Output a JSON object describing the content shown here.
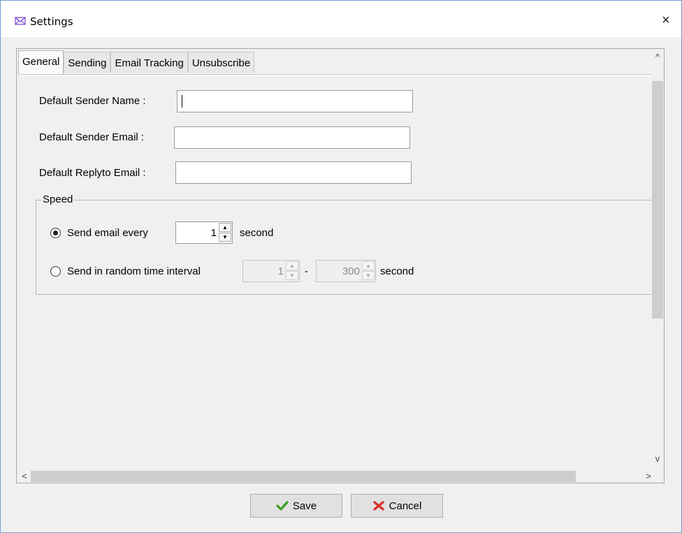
{
  "window": {
    "title": "Settings",
    "close_symbol": "×"
  },
  "tabs": [
    {
      "label": "General",
      "active": true
    },
    {
      "label": "Sending",
      "active": false
    },
    {
      "label": "Email Tracking",
      "active": false
    },
    {
      "label": "Unsubscribe",
      "active": false
    }
  ],
  "form": {
    "sender_name_label": "Default Sender Name :",
    "sender_name_value": "",
    "sender_email_label": "Default Sender Email :",
    "sender_email_value": "",
    "replyto_label": "Default Replyto Email :",
    "replyto_value": ""
  },
  "speed": {
    "group_label": "Speed",
    "option_every_label": "Send email every",
    "every_value": "1",
    "every_unit": "second",
    "option_random_label": "Send in random time interval",
    "random_min": "1",
    "random_separator": "-",
    "random_max": "300",
    "random_unit": "second",
    "selected_option": "every"
  },
  "buttons": {
    "save_label": "Save",
    "cancel_label": "Cancel"
  },
  "icons": {
    "up": "▲",
    "down": "▼",
    "scroll_up": "^",
    "scroll_down": "v",
    "scroll_left": "<",
    "scroll_right": ">"
  },
  "colors": {
    "window_border": "#6b9bd4",
    "save_icon": "#3ea01c",
    "cancel_icon": "#d8322b"
  }
}
